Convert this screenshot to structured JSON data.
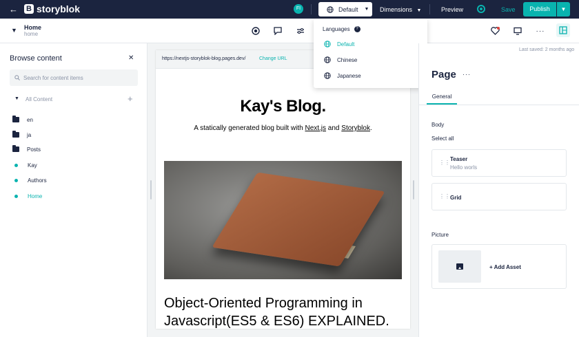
{
  "topbar": {
    "brand": "storyblok",
    "avatar_initials": "FI",
    "language_button": "Default",
    "dimensions_label": "Dimensions",
    "preview_label": "Preview",
    "save_label": "Save",
    "publish_label": "Publish"
  },
  "breadcrumb": {
    "title": "Home",
    "slug": "home"
  },
  "language_menu": {
    "heading": "Languages",
    "items": [
      {
        "label": "Default",
        "active": true
      },
      {
        "label": "Chinese",
        "active": false
      },
      {
        "label": "Japanese",
        "active": false
      }
    ]
  },
  "sidebar": {
    "title": "Browse content",
    "search_placeholder": "Search for content items",
    "all_content_label": "All Content",
    "items": [
      {
        "label": "en",
        "kind": "folder"
      },
      {
        "label": "ja",
        "kind": "folder"
      },
      {
        "label": "Posts",
        "kind": "folder"
      },
      {
        "label": "Kay",
        "kind": "story"
      },
      {
        "label": "Authors",
        "kind": "story"
      },
      {
        "label": "Home",
        "kind": "story",
        "active": true
      }
    ]
  },
  "preview": {
    "url": "https://nextjs-storyblok-blog.pages.dev/",
    "change_url_label": "Change URL",
    "blog_title": "Kay's Blog.",
    "subtitle_prefix": "A statically generated blog built with ",
    "subtitle_link1": "Next.js",
    "subtitle_and": " and ",
    "subtitle_link2": "Storyblok",
    "subtitle_suffix": ".",
    "post_title": "Object-Oriented Programming in Javascript(ES5 & ES6) EXPLAINED."
  },
  "editor": {
    "last_saved": "Last saved: 2 months ago",
    "page_title": "Page",
    "tab_general": "General",
    "body_label": "Body",
    "select_all": "Select all",
    "blocks": [
      {
        "title": "Teaser",
        "subtitle": "Hello worls"
      },
      {
        "title": "Grid",
        "subtitle": ""
      }
    ],
    "picture_label": "Picture",
    "add_asset_label": "+ Add Asset"
  },
  "colors": {
    "brand_dark": "#1b243f",
    "accent": "#09b3af"
  }
}
